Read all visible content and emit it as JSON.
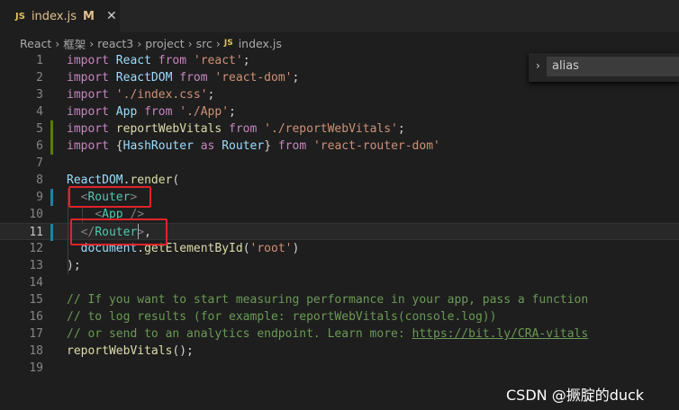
{
  "tab": {
    "badge": "JS",
    "filename": "index.js",
    "modified": "M",
    "close": "✕"
  },
  "breadcrumb": {
    "items": [
      "React",
      "框架",
      "react3",
      "project",
      "src"
    ],
    "file_badge": "JS",
    "file": "index.js"
  },
  "find": {
    "chevron": "›",
    "value": "alias"
  },
  "lines": [
    {
      "n": "1",
      "tokens": [
        [
          "kw",
          "import"
        ],
        [
          "",
          ""
        ],
        [
          "var",
          " React"
        ],
        [
          "kw",
          " from"
        ],
        [
          "str",
          " 'react'"
        ],
        [
          "",
          ";"
        ]
      ]
    },
    {
      "n": "2",
      "tokens": [
        [
          "kw",
          "import"
        ],
        [
          "var",
          " ReactDOM"
        ],
        [
          "kw",
          " from"
        ],
        [
          "str",
          " 'react-dom'"
        ],
        [
          "",
          ";"
        ]
      ]
    },
    {
      "n": "3",
      "tokens": [
        [
          "kw",
          "import"
        ],
        [
          "str",
          " './index.css'"
        ],
        [
          "",
          ";"
        ]
      ]
    },
    {
      "n": "4",
      "tokens": [
        [
          "kw",
          "import"
        ],
        [
          "var",
          " App"
        ],
        [
          "kw",
          " from"
        ],
        [
          "str",
          " './App'"
        ],
        [
          "",
          ";"
        ]
      ]
    },
    {
      "n": "5",
      "tokens": [
        [
          "kw",
          "import"
        ],
        [
          "fn",
          " reportWebVitals"
        ],
        [
          "kw",
          " from"
        ],
        [
          "str",
          " './reportWebVitals'"
        ],
        [
          "",
          ";"
        ]
      ]
    },
    {
      "n": "6",
      "tokens": [
        [
          "kw",
          "import"
        ],
        [
          "",
          " {"
        ],
        [
          "var",
          "HashRouter"
        ],
        [
          "kw",
          " as"
        ],
        [
          "var",
          " Router"
        ],
        [
          "",
          "}"
        ],
        [
          "kw",
          " from"
        ],
        [
          "str",
          " 'react-router-dom'"
        ]
      ]
    },
    {
      "n": "7",
      "tokens": []
    },
    {
      "n": "8",
      "tokens": [
        [
          "var",
          "ReactDOM"
        ],
        [
          "",
          "."
        ],
        [
          "fn",
          "render"
        ],
        [
          "",
          "("
        ]
      ]
    },
    {
      "n": "9",
      "tokens": [
        [
          "",
          "  "
        ],
        [
          "pun",
          "<"
        ],
        [
          "tag",
          "Router"
        ],
        [
          "pun",
          ">"
        ]
      ]
    },
    {
      "n": "10",
      "tokens": [
        [
          "",
          "    "
        ],
        [
          "pun",
          "<"
        ],
        [
          "tag",
          "App"
        ],
        [
          "",
          " "
        ],
        [
          "pun",
          "/>"
        ]
      ]
    },
    {
      "n": "11",
      "tokens": [
        [
          "",
          "  "
        ],
        [
          "pun",
          "</"
        ],
        [
          "tag",
          "Router"
        ],
        [
          "pun",
          ">"
        ],
        [
          "",
          ","
        ]
      ]
    },
    {
      "n": "12",
      "tokens": [
        [
          "",
          "  "
        ],
        [
          "var",
          "document"
        ],
        [
          "",
          "."
        ],
        [
          "fn",
          "getElementById"
        ],
        [
          "",
          "("
        ],
        [
          "str",
          "'root'"
        ],
        [
          "",
          ")"
        ]
      ]
    },
    {
      "n": "13",
      "tokens": [
        [
          "",
          ");"
        ]
      ]
    },
    {
      "n": "14",
      "tokens": []
    },
    {
      "n": "15",
      "tokens": [
        [
          "cmt",
          "// If you want to start measuring performance in your app, pass a function"
        ]
      ]
    },
    {
      "n": "16",
      "tokens": [
        [
          "cmt",
          "// to log results (for example: reportWebVitals(console.log))"
        ]
      ]
    },
    {
      "n": "17",
      "tokens": [
        [
          "cmt",
          "// or send to an analytics endpoint. Learn more: "
        ],
        [
          "link",
          "https://bit.ly/CRA-vitals"
        ]
      ]
    },
    {
      "n": "18",
      "tokens": [
        [
          "fn",
          "reportWebVitals"
        ],
        [
          "",
          "();"
        ]
      ]
    },
    {
      "n": "19",
      "tokens": []
    }
  ],
  "active_line": "11",
  "watermark": "CSDN @撅腚的duck",
  "colors": {
    "highlight_box": "#e2232a",
    "gutter_modified": "#1b81a8",
    "gutter_added": "#587c0c"
  }
}
